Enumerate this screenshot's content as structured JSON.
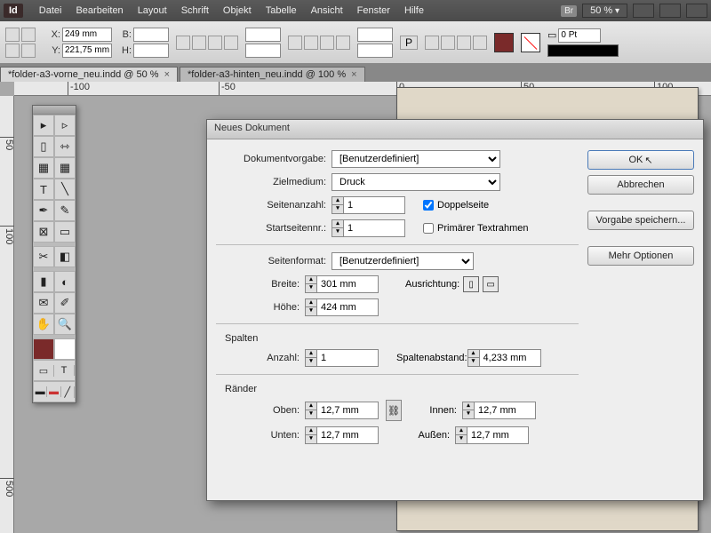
{
  "menubar": {
    "items": [
      "Datei",
      "Bearbeiten",
      "Layout",
      "Schrift",
      "Objekt",
      "Tabelle",
      "Ansicht",
      "Fenster",
      "Hilfe"
    ],
    "br_label": "Br",
    "zoom": "50 %"
  },
  "controlbar": {
    "x_label": "X:",
    "x": "249 mm",
    "y_label": "Y:",
    "y": "221,75 mm",
    "w_label": "B:",
    "w": "",
    "h_label": "H:",
    "h": "",
    "stroke_pt_label": "0 Pt"
  },
  "doctabs": {
    "tab1": "*folder-a3-vorne_neu.indd @ 50 %",
    "tab2": "*folder-a3-hinten_neu.indd @ 100 %"
  },
  "ruler_h": [
    "-100",
    "-50",
    "0",
    "50",
    "100"
  ],
  "ruler_v": [
    "50",
    "100",
    "500"
  ],
  "dialog": {
    "title": "Neues Dokument",
    "preset_label": "Dokumentvorgabe:",
    "preset_value": "[Benutzerdefiniert]",
    "intent_label": "Zielmedium:",
    "intent_value": "Druck",
    "pages_label": "Seitenanzahl:",
    "pages_value": "1",
    "start_label": "Startseitennr.:",
    "start_value": "1",
    "facing_label": "Doppelseite",
    "primary_label": "Primärer Textrahmen",
    "facing_checked": true,
    "primary_checked": false,
    "pagesize_label": "Seitenformat:",
    "pagesize_value": "[Benutzerdefiniert]",
    "width_label": "Breite:",
    "width_value": "301 mm",
    "height_label": "Höhe:",
    "height_value": "424 mm",
    "orient_label": "Ausrichtung:",
    "columns_title": "Spalten",
    "col_count_label": "Anzahl:",
    "col_count_value": "1",
    "gutter_label": "Spaltenabstand:",
    "gutter_value": "4,233 mm",
    "margins_title": "Ränder",
    "top_label": "Oben:",
    "bottom_label": "Unten:",
    "inside_label": "Innen:",
    "outside_label": "Außen:",
    "margin_value": "12,7 mm",
    "ok": "OK",
    "cancel": "Abbrechen",
    "save": "Vorgabe speichern...",
    "more": "Mehr Optionen"
  }
}
